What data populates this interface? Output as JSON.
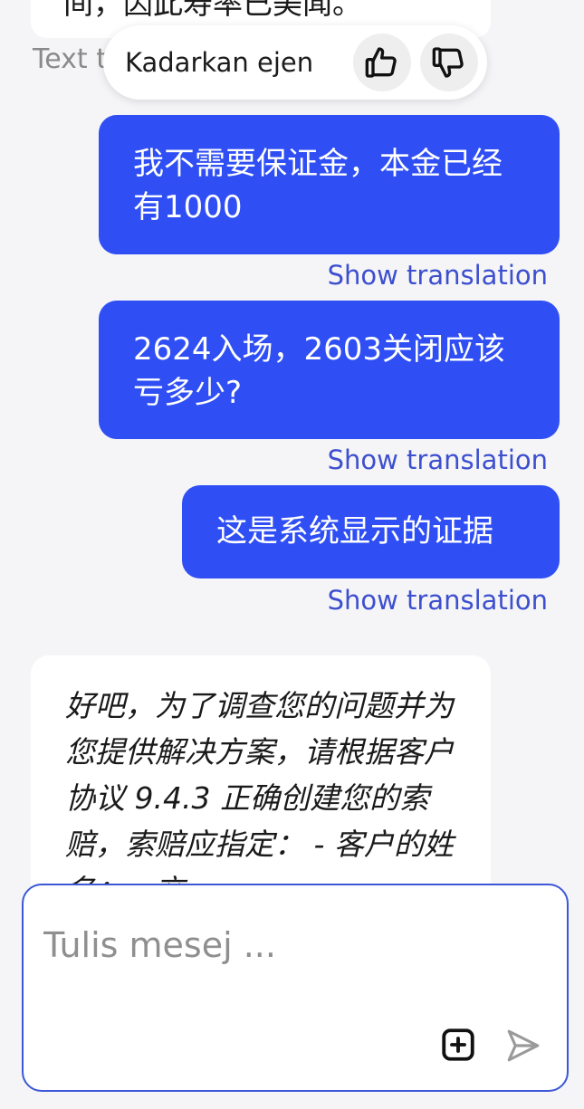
{
  "top_partial": {
    "text": "间，因此寿率已美闻。",
    "caption": "Text t"
  },
  "rate": {
    "label": "Kadarkan ejen",
    "like_icon": "thumbs-up-icon",
    "dislike_icon": "thumbs-down-icon"
  },
  "messages": [
    {
      "text": "我不需要保证金，本金已经有1000",
      "translate_label": "Show translation"
    },
    {
      "text": "2624入场，2603关闭应该亏多少?",
      "translate_label": "Show translation"
    },
    {
      "text": "这是系统显示的证据",
      "translate_label": "Show translation"
    }
  ],
  "agent_message": {
    "text": "好吧，为了调查您的问题并为您提供解决方案，请根据客户协议 9.4.3 正确创建您的索赔，索赔应指定： - 客户的姓名； - 交"
  },
  "composer": {
    "placeholder": "Tulis mesej ...",
    "attach_icon": "plus-square-icon",
    "send_icon": "send-icon"
  },
  "colors": {
    "outgoing_bubble": "#2f4ff5",
    "link": "#3d4fcf",
    "background": "#f5f5f7",
    "composer_border": "#3b57d6"
  }
}
